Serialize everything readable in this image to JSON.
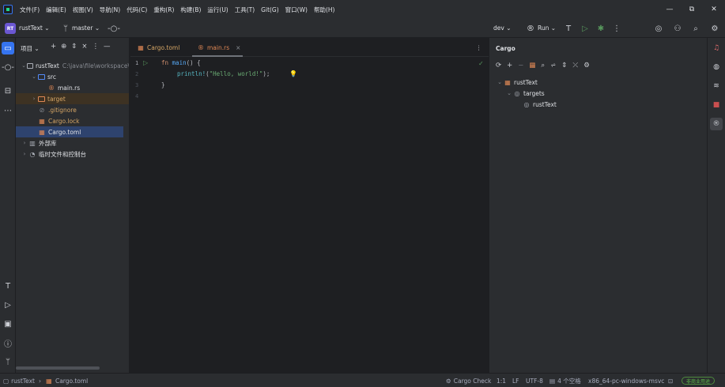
{
  "menu": [
    "文件(F)",
    "编辑(E)",
    "视图(V)",
    "导航(N)",
    "代码(C)",
    "重构(R)",
    "构建(B)",
    "运行(U)",
    "工具(T)",
    "Git(G)",
    "窗口(W)",
    "帮助(H)"
  ],
  "window": {
    "minimize": "—",
    "restore": "⧉",
    "close": "✕"
  },
  "toolbar": {
    "project_badge": "RT",
    "project_name": "rustText ⌄",
    "branch": "master ⌄",
    "run_config": "dev ⌄",
    "run_label": "Run ⌄"
  },
  "project_panel": {
    "title": "项目 ⌄",
    "tree": [
      {
        "label": "rustText",
        "detail": "C:\\java\\file\\workspace\\",
        "chev": "⌄"
      },
      {
        "label": "src",
        "chev": "⌄"
      },
      {
        "label": "main.rs"
      },
      {
        "label": "target",
        "chev": "›"
      },
      {
        "label": ".gitignore"
      },
      {
        "label": "Cargo.lock"
      },
      {
        "label": "Cargo.toml"
      },
      {
        "label": "外部库",
        "chev": "›"
      },
      {
        "label": "临时文件和控制台",
        "chev": "›"
      }
    ]
  },
  "editor": {
    "tabs": [
      {
        "label": "Cargo.toml"
      },
      {
        "label": "main.rs",
        "close": "×"
      }
    ],
    "line_numbers": [
      "1",
      "2",
      "3",
      "4"
    ],
    "code": {
      "l1_kw": "fn",
      "l1_name": "main",
      "l1_rest": "() {",
      "l2_macro": "println!",
      "l2_open": "(",
      "l2_str": "\"Hello, world!\"",
      "l2_close": ");",
      "l3": "}"
    }
  },
  "cargo_panel": {
    "title": "Cargo",
    "tree": [
      {
        "label": "rustText",
        "chev": "⌄"
      },
      {
        "label": "targets",
        "chev": "⌄"
      },
      {
        "label": "rustText"
      }
    ]
  },
  "status": {
    "breadcrumb_project": "rustText",
    "breadcrumb_sep": "›",
    "breadcrumb_file": "Cargo.toml",
    "cargo_check": "Cargo Check",
    "position": "1:1",
    "line_sep": "LF",
    "encoding": "UTF-8",
    "indent": "4 个空格",
    "toolchain": "x86_64-pc-windows-msvc",
    "badge": "非商业用途"
  },
  "colors": {
    "accent": "#3574f0",
    "badge": "#6b57d2",
    "string": "#6aab73",
    "keyword": "#cf8e6d",
    "function": "#56a8f5"
  }
}
